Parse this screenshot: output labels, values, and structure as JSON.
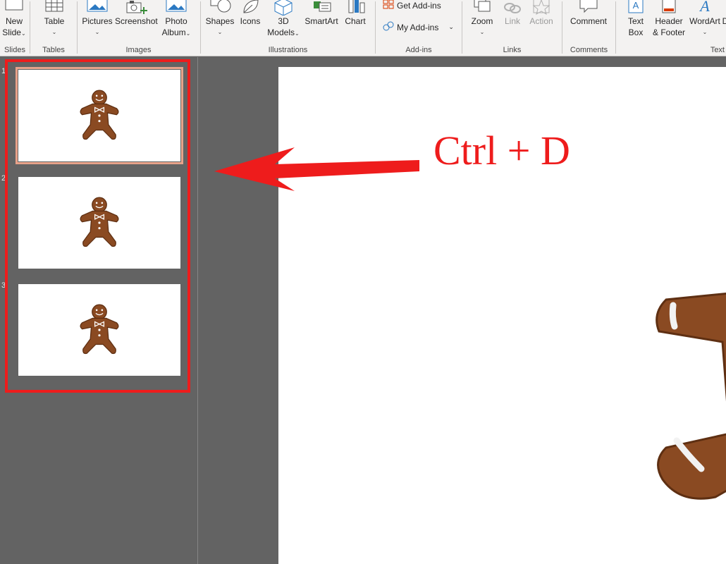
{
  "ribbon": {
    "groups": {
      "slides": {
        "label": "Slides",
        "new_slide_line1": "New",
        "new_slide_line2": "Slide"
      },
      "tables": {
        "label": "Tables",
        "table": "Table"
      },
      "images": {
        "label": "Images",
        "pictures": "Pictures",
        "screenshot": "Screenshot",
        "photo_album_line1": "Photo",
        "photo_album_line2": "Album"
      },
      "illustrations": {
        "label": "Illustrations",
        "shapes": "Shapes",
        "icons": "Icons",
        "models_line1": "3D",
        "models_line2": "Models",
        "smartart": "SmartArt",
        "chart": "Chart"
      },
      "addins": {
        "label": "Add-ins",
        "get_addins": "Get Add-ins",
        "my_addins": "My Add-ins"
      },
      "links": {
        "label": "Links",
        "zoom": "Zoom",
        "link": "Link",
        "action": "Action"
      },
      "comments": {
        "label": "Comments",
        "comment": "Comment"
      },
      "text": {
        "label": "Text",
        "text_box_line1": "Text",
        "text_box_line2": "Box",
        "header_footer_line1": "Header",
        "header_footer_line2": "& Footer",
        "wordart": "WordArt",
        "truncated": "D"
      }
    }
  },
  "thumbnails": [
    {
      "number": "1",
      "selected": true
    },
    {
      "number": "2",
      "selected": false
    },
    {
      "number": "3",
      "selected": false
    }
  ],
  "annotation": {
    "text": "Ctrl + D",
    "color": "#ee1c1c"
  },
  "colors": {
    "ribbon_bg": "#f3f2f1",
    "pane_bg": "#636363",
    "accent_red": "#ee1c1c",
    "selection": "#e8a28a",
    "gingerbread": "#8a4a22"
  }
}
